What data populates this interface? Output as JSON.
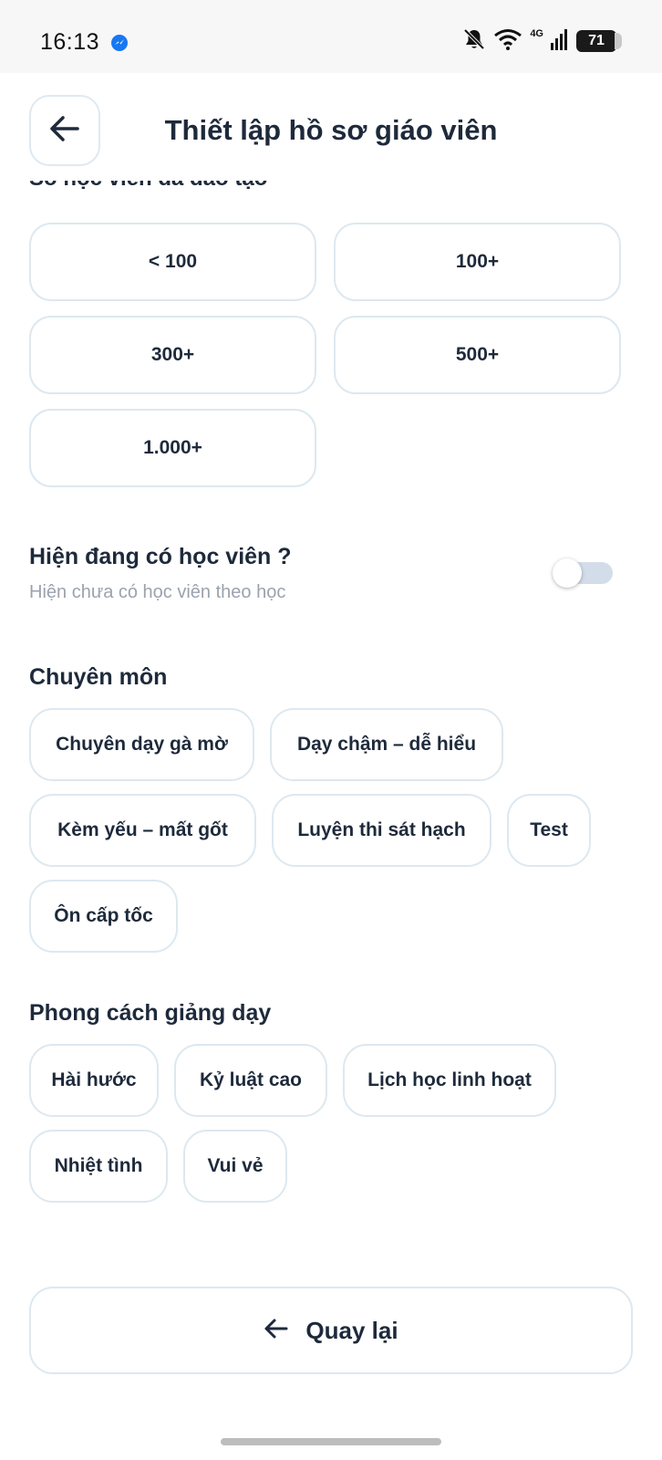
{
  "status_bar": {
    "time": "16:13",
    "network": "4G",
    "battery": "71",
    "icons": [
      "messenger-icon",
      "bell-off-icon",
      "wifi-icon",
      "signal-icon",
      "battery-icon"
    ]
  },
  "header": {
    "title": "Thiết lập hồ sơ giáo viên",
    "back_icon": "arrow-left-icon"
  },
  "students_trained": {
    "heading": "Số học viên đã đào tạo",
    "options": [
      "< 100",
      "100+",
      "300+",
      "500+",
      "1.000+"
    ]
  },
  "current_students": {
    "title": "Hiện đang có học viên ?",
    "subtitle": "Hiện chưa có học viên theo học",
    "toggle_on": false
  },
  "specialty": {
    "title": "Chuyên môn",
    "chips": [
      "Chuyên dạy gà mờ",
      "Dạy chậm – dễ hiểu",
      "Kèm yếu – mất gốt",
      "Luyện thi sát hạch",
      "Test",
      "Ôn cấp tốc"
    ]
  },
  "teaching_style": {
    "title": "Phong cách giảng dạy",
    "chips": [
      "Hài hước",
      "Kỷ luật cao",
      "Lịch học linh hoạt",
      "Nhiệt tình",
      "Vui vẻ"
    ]
  },
  "footer": {
    "back_label": "Quay lại",
    "back_icon": "arrow-left-icon"
  },
  "colors": {
    "text": "#1e2a3b",
    "border": "#dde8f0",
    "muted": "#9aa3ad",
    "toggle_track": "#d3dde9"
  }
}
